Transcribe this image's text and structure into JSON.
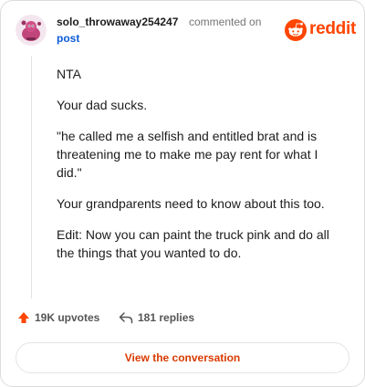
{
  "header": {
    "username": "solo_throwaway254247",
    "action": "commented on",
    "post_link": "post",
    "brand": "reddit"
  },
  "comment": {
    "paragraphs": [
      "NTA",
      "Your dad sucks.",
      "\"he called me a selfish and entitled brat and is threatening me to make me pay rent for what I did.\"",
      "Your grandparents need to know about this too.",
      "Edit: Now you can paint the truck pink and do all the things that you wanted to do."
    ]
  },
  "footer": {
    "upvotes": "19K upvotes",
    "replies": "181 replies"
  },
  "cta": {
    "label": "View the conversation"
  },
  "colors": {
    "brand": "#ff4500",
    "link": "#0b5bd9",
    "cta_text": "#d93a00"
  },
  "icons": [
    "avatar",
    "reddit-logo-icon",
    "upvote-arrow-icon",
    "reply-arrow-icon"
  ]
}
